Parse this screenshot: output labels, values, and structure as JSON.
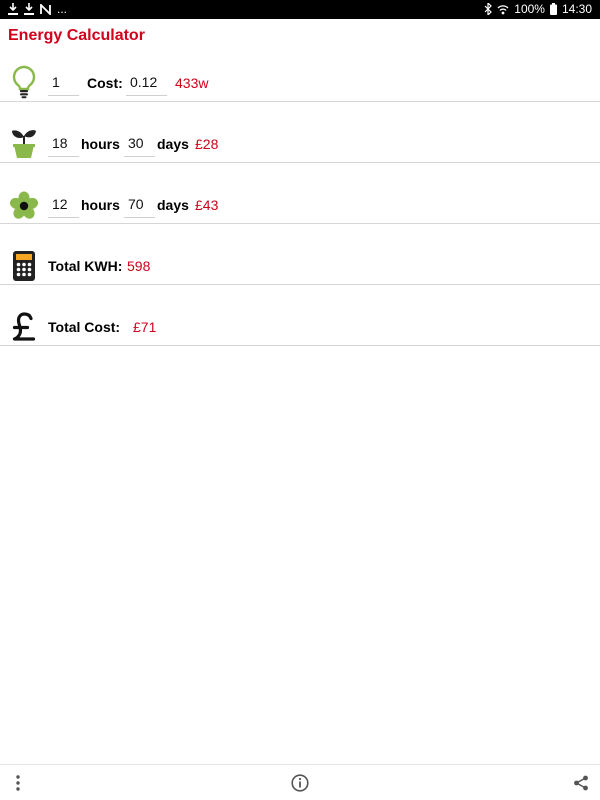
{
  "status_bar": {
    "left_icons": [
      "download-icon",
      "download-icon",
      "n-notification-icon"
    ],
    "ellipsis": "...",
    "right_icons": [
      "bluetooth-icon",
      "wifi-icon"
    ],
    "battery": "100%",
    "time": "14:30"
  },
  "app": {
    "title": "Energy Calculator"
  },
  "rows": {
    "bulb": {
      "icon": "lightbulb-icon",
      "count": "1",
      "cost_label": "Cost:",
      "cost_value": "0.12",
      "result": "433w"
    },
    "plant": {
      "icon": "plant-pot-icon",
      "hours_value": "18",
      "hours_label": "hours",
      "days_value": "30",
      "days_label": "days",
      "result": "£28"
    },
    "fan": {
      "icon": "fan-icon",
      "hours_value": "12",
      "hours_label": "hours",
      "days_value": "70",
      "days_label": "days",
      "result": "£43"
    },
    "total_kwh": {
      "icon": "calculator-icon",
      "label": "Total KWH:",
      "value": "598"
    },
    "total_cost": {
      "icon": "pound-sign-icon",
      "label": "Total Cost:",
      "value": "£71"
    }
  },
  "bottom_bar": {
    "left": "more-vert-icon",
    "center": "info-icon",
    "right": "share-icon"
  },
  "colors": {
    "accent": "#d0021b",
    "icon_green": "#8bb84a"
  }
}
